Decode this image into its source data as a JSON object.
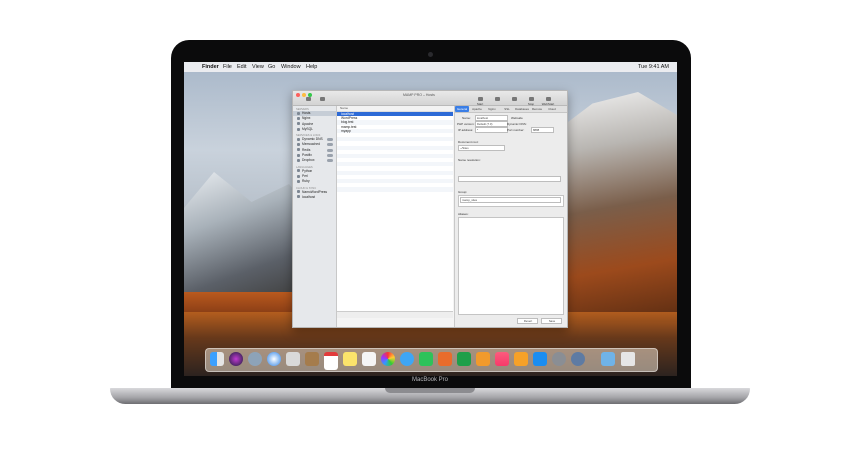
{
  "device": {
    "brand": "MacBook Pro"
  },
  "menubar": {
    "apple": "",
    "items": [
      "Finder",
      "File",
      "Edit",
      "View",
      "Go",
      "Window",
      "Help"
    ],
    "clock": "Tue 9:41 AM"
  },
  "window": {
    "title": "MAMP PRO – Hosts",
    "toolbar": [
      "",
      "",
      "Start",
      "",
      "",
      "Stop",
      "WebStart"
    ],
    "sidebar": {
      "sections": [
        "Servers",
        "Services & Logs",
        "Languages",
        "Cloud & Sync"
      ],
      "items": [
        "Hosts",
        "Nginx",
        "Apache",
        "MySQL",
        "Dynamic DNS",
        "Memcached",
        "Redis",
        "Postfix",
        "Dropbox",
        "Python",
        "Perl",
        "Ruby",
        "NamoWordPress",
        "localhost"
      ]
    },
    "list": {
      "header": "Name",
      "rows": [
        "localhost",
        "WordPress",
        "blog.test",
        "mamp.test",
        "myapp"
      ]
    },
    "inspector": {
      "tabs": [
        "General",
        "Apache",
        "Nginx",
        "SSL",
        "Databases",
        "Remote",
        "Cloud"
      ],
      "labels": {
        "name": "Name:",
        "php": "PHP version:",
        "ip": "IP address:",
        "document_root": "Document root:",
        "name_resolution": "Name resolution:",
        "group": "Group:",
        "aliases": "Aliases:",
        "websafe": "Websafe",
        "dyndns": "Dynamic DNS:",
        "port": "Port number:"
      },
      "values": {
        "name": "localhost",
        "php": "Default (7.0)",
        "ip": "*",
        "port": "8888",
        "document_root": "~/Sites",
        "group": "mamp_sites"
      },
      "buttons": {
        "revert": "Revert",
        "save": "Save"
      }
    }
  }
}
